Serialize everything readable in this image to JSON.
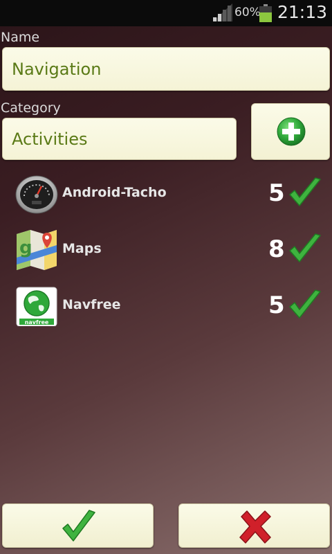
{
  "status_bar": {
    "battery_percent": "60%",
    "time": "21:13",
    "battery_level": 0.6,
    "colors": {
      "battery": "#8cc63f",
      "background": "#0b0b0b"
    }
  },
  "form": {
    "name_label": "Name",
    "name_value": "Navigation",
    "category_label": "Category",
    "category_value": "Activities",
    "add_category_icon": "plus-circle-icon"
  },
  "apps": [
    {
      "name": "Android-Tacho",
      "count": "5",
      "icon": "speedometer-icon",
      "status_icon": "checkmark-icon"
    },
    {
      "name": "Maps",
      "count": "8",
      "icon": "google-maps-icon",
      "status_icon": "checkmark-icon"
    },
    {
      "name": "Navfree",
      "count": "5",
      "icon": "navfree-globe-icon",
      "status_icon": "checkmark-icon"
    }
  ],
  "navfree_logo_text": "navfree",
  "buttons": {
    "confirm_icon": "checkmark-icon",
    "cancel_icon": "red-x-icon"
  },
  "colors": {
    "field_text": "#5a7a16",
    "field_background": "#f7f5dc",
    "accent_green": "#3fb33f",
    "cancel_red": "#d0202a"
  }
}
